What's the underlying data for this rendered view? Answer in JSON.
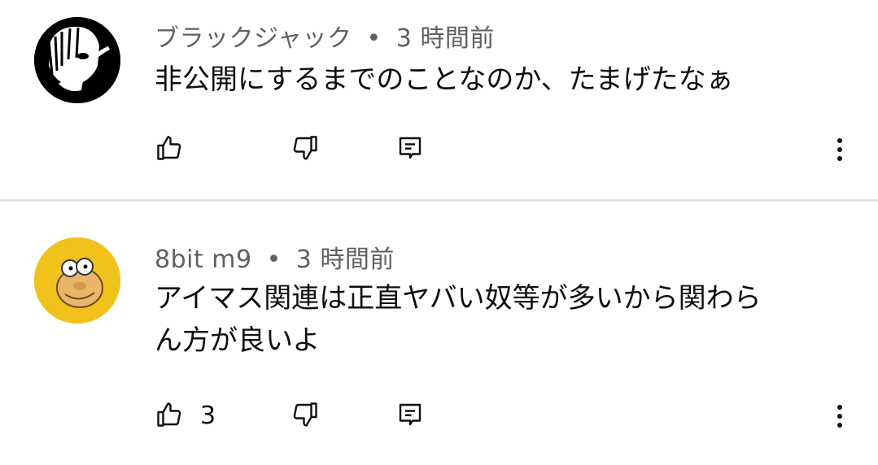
{
  "comments": [
    {
      "author": "ブラックジャック",
      "separator": "•",
      "time": "3 時間前",
      "text": "非公開にするまでのことなのか、たまげたなぁ",
      "like_count": "",
      "avatar_icon": "monochrome-manga-avatar-icon"
    },
    {
      "author": "8bit m9",
      "separator": "•",
      "time": "3 時間前",
      "text": "アイマス関連は正直ヤバい奴等が多いから関わら\nん方が良いよ",
      "like_count": "3",
      "avatar_icon": "cartoon-character-avatar-icon"
    }
  ],
  "colors": {
    "meta_text": "#606060",
    "body_text": "#0f0f0f",
    "divider": "#e5e5e5",
    "avatar2_bg": "#f1c21b"
  }
}
